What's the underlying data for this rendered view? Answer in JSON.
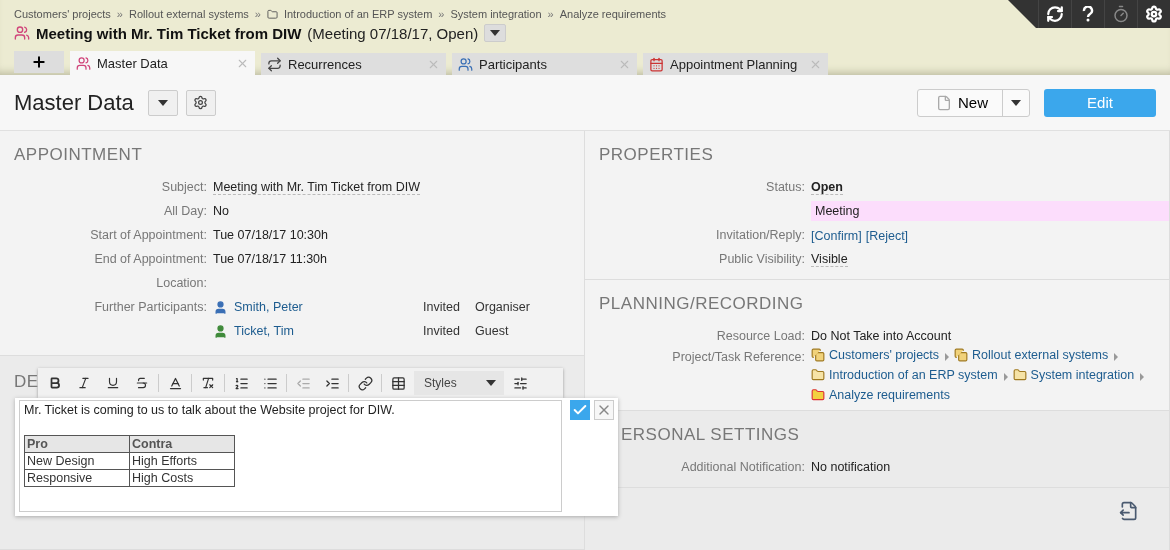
{
  "breadcrumb": [
    {
      "label": "Customers' projects",
      "kind": "plain"
    },
    {
      "label": "Rollout external systems",
      "kind": "plain",
      "separator": "»"
    },
    {
      "label": "Introduction of an ERP system",
      "kind": "folder",
      "separator": "»"
    },
    {
      "label": "System integration",
      "kind": "plain",
      "separator": "»"
    },
    {
      "label": "Analyze requirements",
      "kind": "plain",
      "separator": "»"
    }
  ],
  "record": {
    "title": "Meeting with Mr. Tim Ticket from DIW",
    "subtitle": "(Meeting 07/18/17, Open)"
  },
  "tabs": [
    {
      "label": "Master Data",
      "selected": true,
      "kind": "meeting"
    },
    {
      "label": "Recurrences",
      "selected": false,
      "kind": "recurrence"
    },
    {
      "label": "Participants",
      "selected": false,
      "kind": "participants"
    },
    {
      "label": "Appointment Planning",
      "selected": false,
      "kind": "calendar"
    }
  ],
  "page": {
    "title": "Master Data",
    "new_button": "New",
    "edit_button": "Edit"
  },
  "appointment": {
    "heading": "APPOINTMENT",
    "fields": [
      {
        "label": "Subject:",
        "value": "Meeting with Mr. Tim Ticket from DIW",
        "kind": "dotted"
      },
      {
        "label": "All Day:",
        "value": "No"
      },
      {
        "label": "Start of Appointment:",
        "value": "Tue 07/18/17 10:30h"
      },
      {
        "label": "End of Appointment:",
        "value": "Tue 07/18/17 11:30h"
      },
      {
        "label": "Location:"
      }
    ],
    "participants_label": "Further Participants:",
    "participants": [
      {
        "name": "Smith, Peter",
        "status": "Invited",
        "role": "Organiser",
        "color": "#3a6fb5"
      },
      {
        "name": "Ticket, Tim",
        "status": "Invited",
        "role": "Guest",
        "color": "#3f8a3a"
      }
    ]
  },
  "description": {
    "heading": "DE",
    "styles": "Styles",
    "text": "Mr. Ticket is coming to us to talk about the Website project for DIW.",
    "table": {
      "columns": [
        "Pro",
        "Contra"
      ],
      "rows": [
        [
          "New Design",
          "High Efforts"
        ],
        [
          "Responsive",
          "High Costs"
        ]
      ]
    }
  },
  "properties": {
    "heading": "PROPERTIES",
    "fields": [
      {
        "label": "Status:",
        "value": "Open",
        "kind": "bold"
      },
      {
        "value": "Meeting",
        "kind": "highlight"
      },
      {
        "label": "Invitation/Reply:",
        "links": [
          "[Confirm]",
          "[Reject]"
        ],
        "kind": "links"
      },
      {
        "label": "Public Visibility:",
        "value": "Visible",
        "kind": "dotted"
      }
    ]
  },
  "planning": {
    "heading": "PLANNING/RECORDING",
    "fields": [
      {
        "label": "Resource Load:",
        "value": "Do Not Take into Account"
      }
    ],
    "reference_label": "Project/Task Reference:",
    "reference": [
      {
        "label": "Customers' projects",
        "kind": "project"
      },
      {
        "label": "Rollout external systems",
        "kind": "project"
      },
      {
        "label": "Introduction of an ERP system",
        "kind": "folder"
      },
      {
        "label": "System integration",
        "kind": "folder"
      },
      {
        "label": "Analyze requirements",
        "kind": "task"
      }
    ]
  },
  "personal": {
    "heading": "ERSONAL SETTINGS",
    "fields": [
      {
        "label": "Additional Notification:",
        "value": "No notification"
      }
    ]
  }
}
